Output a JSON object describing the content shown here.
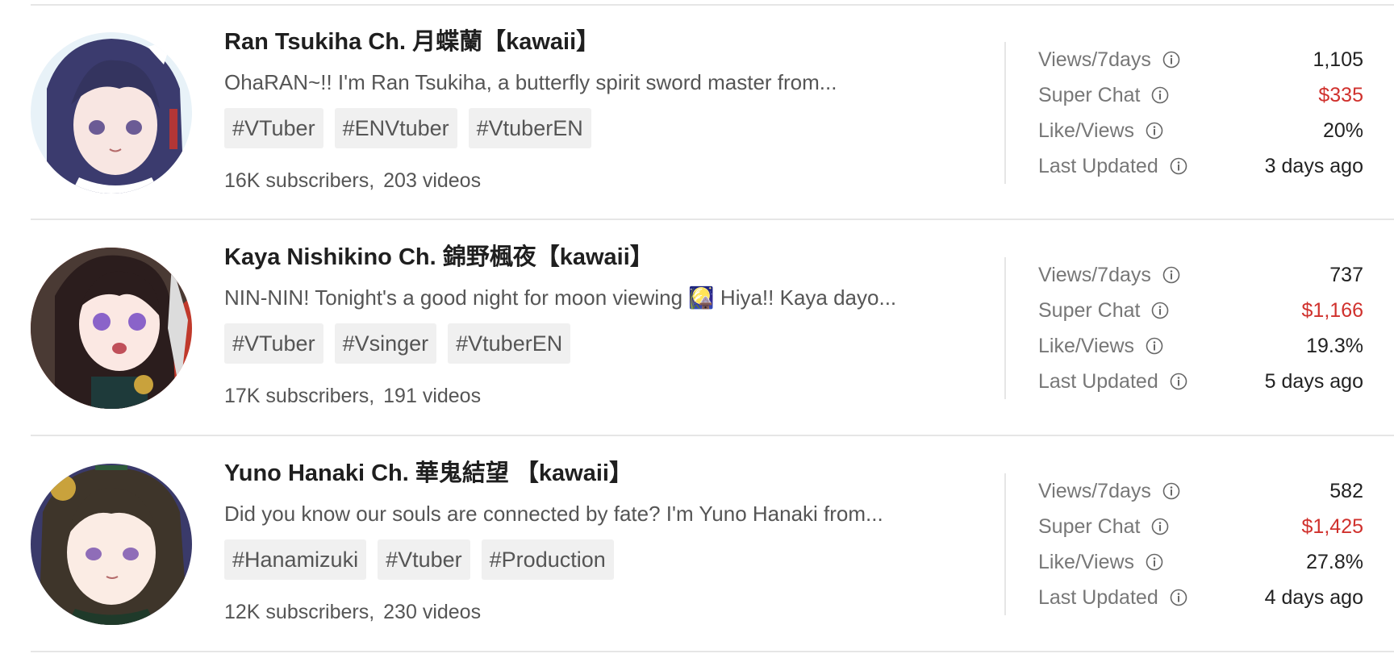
{
  "colors": {
    "superchat_value": "#d0312d",
    "tag_background": "#f0f0f0",
    "divider": "#e6e6e6"
  },
  "stat_labels": {
    "views": "Views/7days",
    "superchat": "Super Chat",
    "likeviews": "Like/Views",
    "updated": "Last Updated"
  },
  "channels": [
    {
      "name": "Ran Tsukiha Ch. 月蝶蘭【kawaii】",
      "description": "OhaRAN~!! I'm Ran Tsukiha, a butterfly spirit sword master from...",
      "tags": [
        "#VTuber",
        "#ENVtuber",
        "#VtuberEN"
      ],
      "subscribers": "16K subscribers,",
      "videos": "203 videos",
      "avatar_icon": "avatar-image",
      "stats": {
        "views": "1,105",
        "superchat": "$335",
        "likeviews": "20%",
        "updated": "3 days ago"
      }
    },
    {
      "name": "Kaya Nishikino Ch. 錦野楓夜【kawaii】",
      "description": "NIN-NIN! Tonight's a good night for moon viewing 🎑 Hiya!! Kaya dayo...",
      "tags": [
        "#VTuber",
        "#Vsinger",
        "#VtuberEN"
      ],
      "subscribers": "17K subscribers,",
      "videos": "191 videos",
      "avatar_icon": "avatar-image",
      "stats": {
        "views": "737",
        "superchat": "$1,166",
        "likeviews": "19.3%",
        "updated": "5 days ago"
      }
    },
    {
      "name": "Yuno Hanaki Ch. 華鬼結望 【kawaii】",
      "description": "Did you know our souls are connected by fate? I'm Yuno Hanaki from...",
      "tags": [
        "#Hanamizuki",
        "#Vtuber",
        "#Production"
      ],
      "subscribers": "12K subscribers,",
      "videos": "230 videos",
      "avatar_icon": "avatar-image",
      "stats": {
        "views": "582",
        "superchat": "$1,425",
        "likeviews": "27.8%",
        "updated": "4 days ago"
      }
    }
  ]
}
